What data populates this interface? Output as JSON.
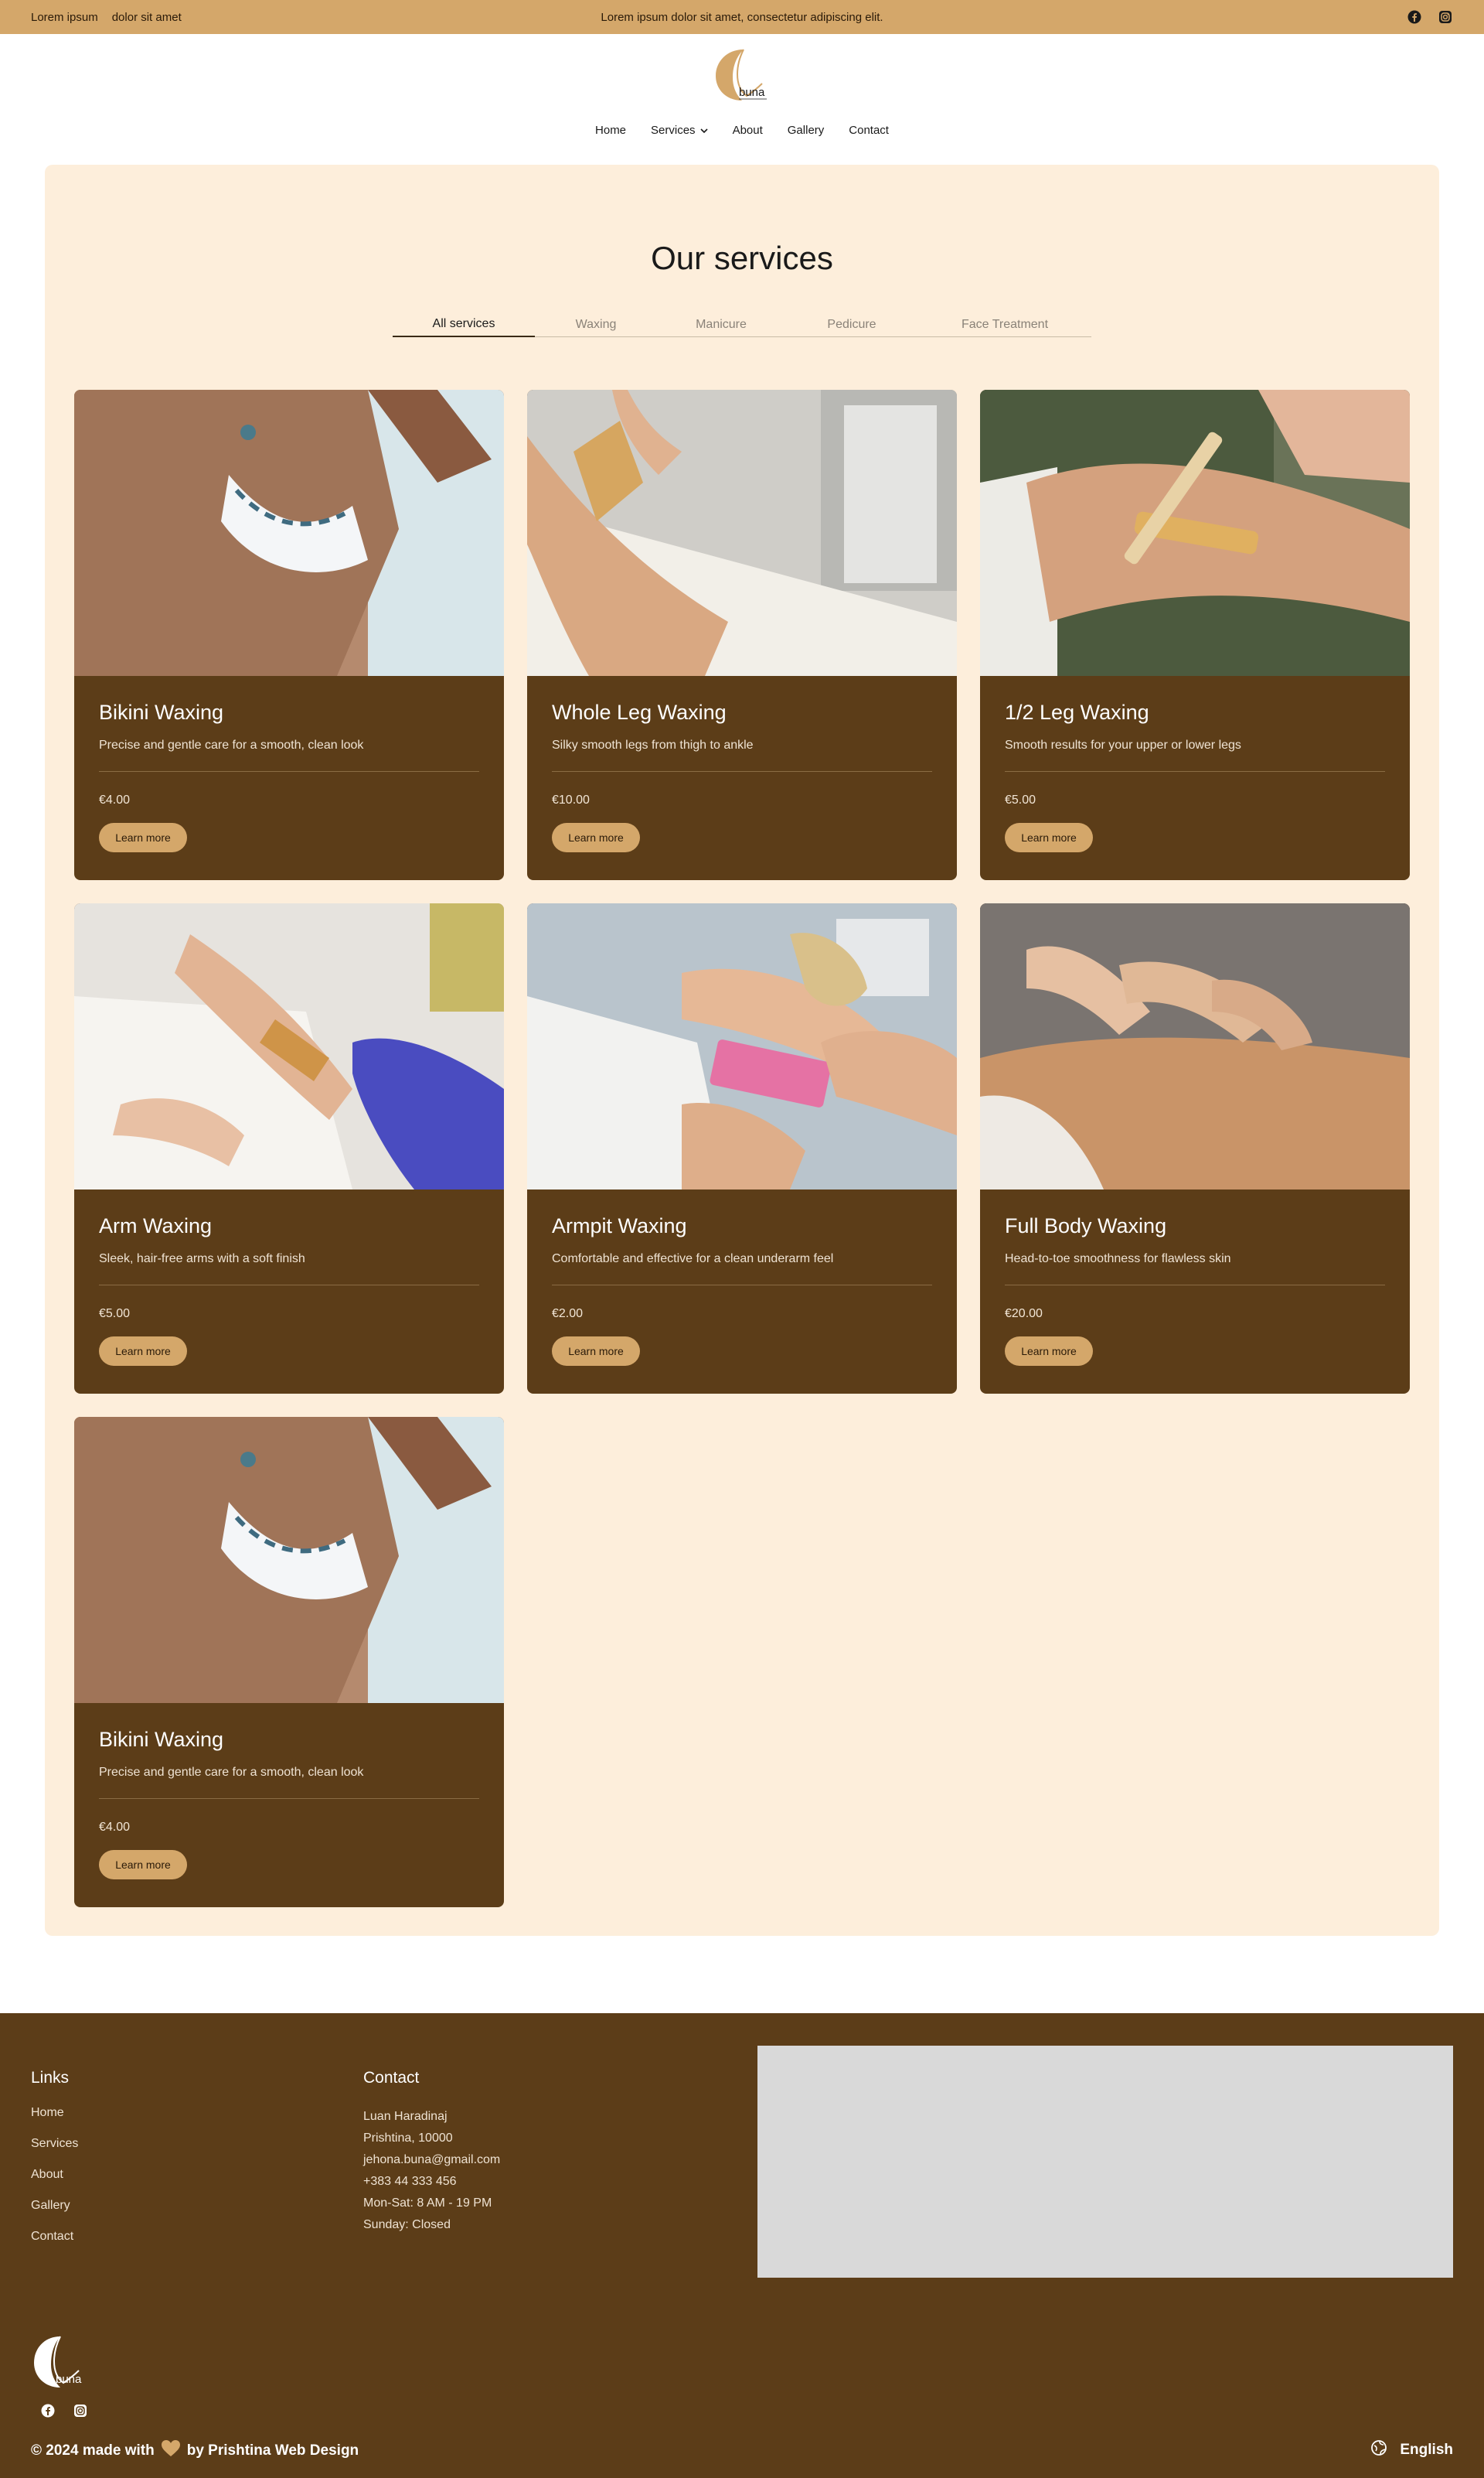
{
  "topbar": {
    "left_text_1": "Lorem ipsum",
    "left_text_2": "dolor sit amet",
    "center_text": "Lorem ipsum dolor sit amet, consectetur adipiscing elit.",
    "social_icons": [
      "facebook-icon",
      "instagram-icon"
    ]
  },
  "brand": {
    "logo_text": "buna"
  },
  "nav": {
    "items": [
      "Home",
      "Services",
      "About",
      "Gallery",
      "Contact"
    ]
  },
  "services": {
    "title": "Our services",
    "tabs": [
      "All services",
      "Waxing",
      "Manicure",
      "Pedicure",
      "Face Treatment"
    ],
    "active_tab": "All services",
    "cards": [
      {
        "title": "Bikini Waxing",
        "desc": "Precise and gentle care for a smooth, clean look",
        "price": "€4.00",
        "button": "Learn more"
      },
      {
        "title": "Whole Leg Waxing",
        "desc": "Silky smooth legs from thigh to ankle",
        "price": "€10.00",
        "button": "Learn more"
      },
      {
        "title": "1/2 Leg Waxing",
        "desc": "Smooth results for your upper or lower legs",
        "price": "€5.00",
        "button": "Learn more"
      },
      {
        "title": "Arm Waxing",
        "desc": "Sleek, hair-free arms with a soft finish",
        "price": "€5.00",
        "button": "Learn more"
      },
      {
        "title": "Armpit Waxing",
        "desc": "Comfortable and effective for a clean underarm feel",
        "price": "€2.00",
        "button": "Learn more"
      },
      {
        "title": "Full Body Waxing",
        "desc": "Head-to-toe smoothness for flawless skin",
        "price": "€20.00",
        "button": "Learn more"
      },
      {
        "title": "Bikini Waxing",
        "desc": "Precise and gentle care for a smooth, clean look",
        "price": "€4.00",
        "button": "Learn more"
      }
    ]
  },
  "footer": {
    "links_title": "Links",
    "links": [
      "Home",
      "Services",
      "About",
      "Gallery",
      "Contact"
    ],
    "contact_title": "Contact",
    "contact_lines": [
      "Luan Haradinaj",
      "Prishtina, 10000",
      "jehona.buna@gmail.com",
      "+383 44 333 456",
      "Mon-Sat: 8 AM - 19 PM",
      "Sunday: Closed"
    ],
    "copyright_prefix": "© 2024 made with",
    "copyright_suffix": "by Prishtina Web Design",
    "language": "English"
  },
  "colors": {
    "accent": "#d4a76a",
    "brown": "#5c3d18",
    "panel": "#fdeedb"
  }
}
